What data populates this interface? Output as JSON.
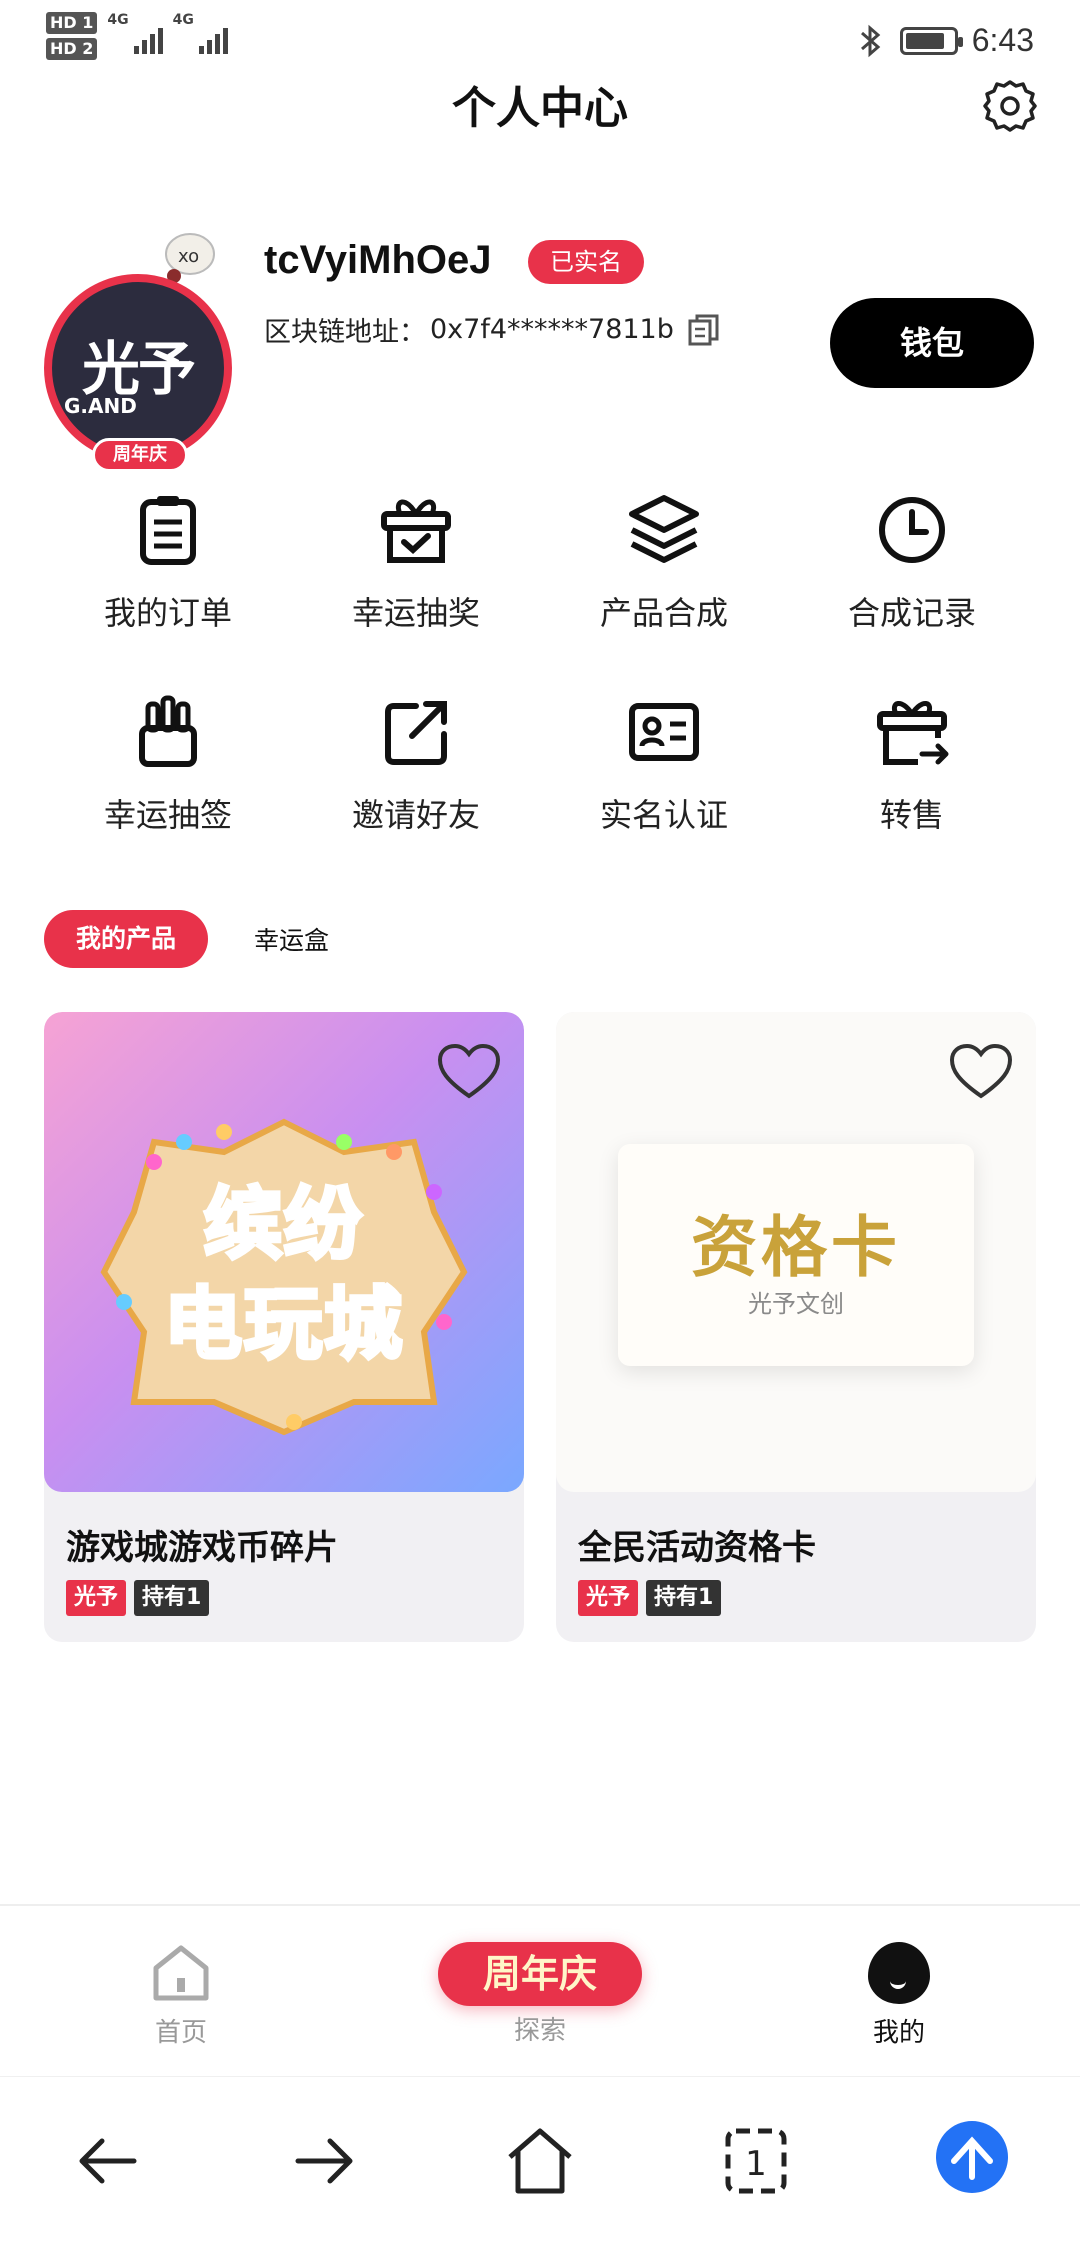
{
  "status_bar": {
    "sim1": "HD 1",
    "sim2": "HD 2",
    "net1": "4G",
    "net2": "4G",
    "time": "6:43"
  },
  "header": {
    "title": "个人中心",
    "settings_icon": "gear-icon"
  },
  "profile": {
    "avatar_brand": "光予",
    "avatar_brand_en": "G.AND",
    "avatar_badge": "周年庆",
    "username": "tcVyiMhOeJ",
    "verified_label": "已实名",
    "chain_label": "区块链地址：",
    "chain_address": "0x7f4******7811b",
    "wallet_button": "钱包"
  },
  "functions": [
    {
      "label": "我的订单",
      "icon": "order-list-icon"
    },
    {
      "label": "幸运抽奖",
      "icon": "gift-box-icon"
    },
    {
      "label": "产品合成",
      "icon": "layers-icon"
    },
    {
      "label": "合成记录",
      "icon": "clock-icon"
    },
    {
      "label": "幸运抽签",
      "icon": "lottery-sticks-icon"
    },
    {
      "label": "邀请好友",
      "icon": "share-icon"
    },
    {
      "label": "实名认证",
      "icon": "id-card-icon"
    },
    {
      "label": "转售",
      "icon": "resale-icon"
    }
  ],
  "tabs": {
    "active": "我的产品",
    "other": "幸运盒"
  },
  "products": [
    {
      "art_line1": "缤纷",
      "art_line2": "电玩城",
      "title": "游戏城游戏币碎片",
      "brand_tag": "光予",
      "hold_tag": "持有1"
    },
    {
      "art_title": "资格卡",
      "art_sub": "光予文创",
      "title": "全民活动资格卡",
      "brand_tag": "光予",
      "hold_tag": "持有1"
    }
  ],
  "bottom_nav": {
    "home": "首页",
    "explore_pill": "周年庆",
    "explore": "探索",
    "me": "我的"
  },
  "system_nav": {
    "tabs_count": "1"
  },
  "colors": {
    "accent_red": "#e8324a",
    "black": "#000000",
    "gold": "#c9a23a"
  }
}
